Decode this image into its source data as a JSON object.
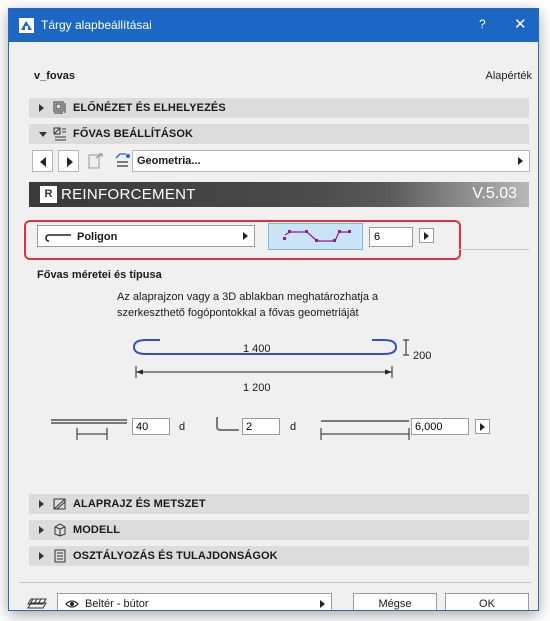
{
  "window": {
    "title": "Tárgy alapbeállításai",
    "help_label": "?",
    "close_label": "✕"
  },
  "object": {
    "name": "v_fovas",
    "default_label": "Alapérték"
  },
  "sections": {
    "preview": "ELŐNÉZET ÉS ELHELYEZÉS",
    "main_settings": "FŐVAS BEÁLLÍTÁSOK",
    "floorplan": "ALAPRAJZ ÉS METSZET",
    "model": "MODELL",
    "classification": "OSZTÁLYOZÁS ÉS TULAJDONSÁGOK"
  },
  "nav": {
    "page_label": "Geometria..."
  },
  "banner": {
    "title": "REINFORCEMENT",
    "version": "V.5.03",
    "logo": "R"
  },
  "shape": {
    "selected": "Poligon",
    "count": "6"
  },
  "dimensions": {
    "heading": "Fővas méretei és típusa",
    "description": "Az alaprajzon vagy a 3D ablakban meghatározhatja a szerkeszthető fogópontokkal a fővas geometriáját",
    "length_top": "1 400",
    "height": "200",
    "length_bottom": "1 200"
  },
  "params": {
    "overlap_value": "40",
    "overlap_unit": "d",
    "hook_value": "2",
    "hook_unit": "d",
    "length_value": "6,000"
  },
  "footer": {
    "layer": "Beltér - bútor",
    "cancel_label": "Mégse",
    "ok_label": "OK"
  },
  "colors": {
    "titlebar": "#1d67c4",
    "highlight": "#e0323c",
    "polygon_button": "#c9e3f7",
    "polygon_line": "#8a1d8f"
  }
}
